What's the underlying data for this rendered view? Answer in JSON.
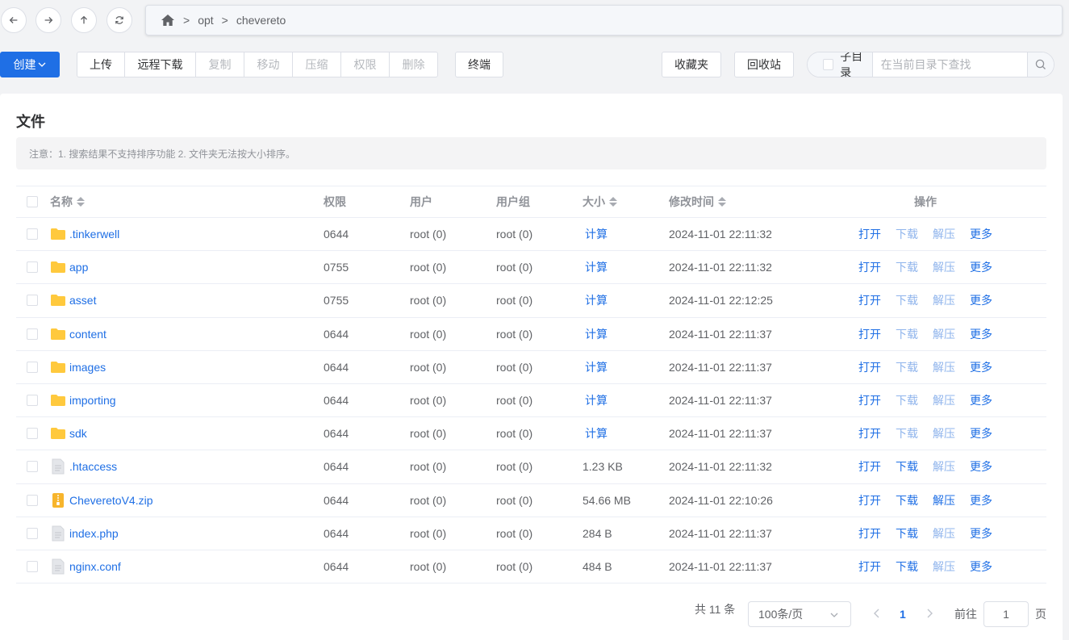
{
  "nav": {
    "back_icon": "arrow-left-icon",
    "forward_icon": "arrow-right-icon",
    "up_icon": "arrow-up-icon",
    "refresh_icon": "refresh-icon"
  },
  "breadcrumb": {
    "home_icon": "home-icon",
    "separator": ">",
    "items": [
      "opt",
      "chevereto"
    ]
  },
  "toolbar": {
    "create": "创建",
    "upload": "上传",
    "remote_download": "远程下载",
    "copy": "复制",
    "move": "移动",
    "compress": "压缩",
    "permission": "权限",
    "delete": "删除",
    "terminal": "终端",
    "favorites": "收藏夹",
    "recycle_bin": "回收站",
    "subdir": "子目录",
    "search_placeholder": "在当前目录下查找"
  },
  "colors": {
    "primary": "#1f6fe5",
    "folder": "#ffc93d",
    "zip": "#f7b52c"
  },
  "card": {
    "title": "文件",
    "notice": "注意：1. 搜索结果不支持排序功能 2. 文件夹无法按大小排序。"
  },
  "table": {
    "headers": {
      "name": "名称",
      "perm": "权限",
      "user": "用户",
      "group": "用户组",
      "size": "大小",
      "mtime": "修改时间",
      "ops": "操作"
    },
    "op_labels": {
      "open": "打开",
      "download": "下载",
      "extract": "解压",
      "more": "更多"
    },
    "rows": [
      {
        "name": ".tinkerwell",
        "type": "folder",
        "perm": "0644",
        "user": "root (0)",
        "group": "root (0)",
        "size": "计算",
        "mtime": "2024-11-01 22:11:32"
      },
      {
        "name": "app",
        "type": "folder",
        "perm": "0755",
        "user": "root (0)",
        "group": "root (0)",
        "size": "计算",
        "mtime": "2024-11-01 22:11:32"
      },
      {
        "name": "asset",
        "type": "folder",
        "perm": "0755",
        "user": "root (0)",
        "group": "root (0)",
        "size": "计算",
        "mtime": "2024-11-01 22:12:25"
      },
      {
        "name": "content",
        "type": "folder",
        "perm": "0644",
        "user": "root (0)",
        "group": "root (0)",
        "size": "计算",
        "mtime": "2024-11-01 22:11:37"
      },
      {
        "name": "images",
        "type": "folder",
        "perm": "0644",
        "user": "root (0)",
        "group": "root (0)",
        "size": "计算",
        "mtime": "2024-11-01 22:11:37"
      },
      {
        "name": "importing",
        "type": "folder",
        "perm": "0644",
        "user": "root (0)",
        "group": "root (0)",
        "size": "计算",
        "mtime": "2024-11-01 22:11:37"
      },
      {
        "name": "sdk",
        "type": "folder",
        "perm": "0644",
        "user": "root (0)",
        "group": "root (0)",
        "size": "计算",
        "mtime": "2024-11-01 22:11:37"
      },
      {
        "name": ".htaccess",
        "type": "file",
        "perm": "0644",
        "user": "root (0)",
        "group": "root (0)",
        "size": "1.23 KB",
        "mtime": "2024-11-01 22:11:32"
      },
      {
        "name": "CheveretoV4.zip",
        "type": "zip",
        "perm": "0644",
        "user": "root (0)",
        "group": "root (0)",
        "size": "54.66 MB",
        "mtime": "2024-11-01 22:10:26"
      },
      {
        "name": "index.php",
        "type": "file",
        "perm": "0644",
        "user": "root (0)",
        "group": "root (0)",
        "size": "284 B",
        "mtime": "2024-11-01 22:11:37"
      },
      {
        "name": "nginx.conf",
        "type": "file",
        "perm": "0644",
        "user": "root (0)",
        "group": "root (0)",
        "size": "484 B",
        "mtime": "2024-11-01 22:11:37"
      }
    ]
  },
  "pagination": {
    "total": "共 11 条",
    "page_size": "100条/页",
    "current_page": "1",
    "goto_label": "前往",
    "goto_value": "1",
    "page_unit": "页"
  }
}
